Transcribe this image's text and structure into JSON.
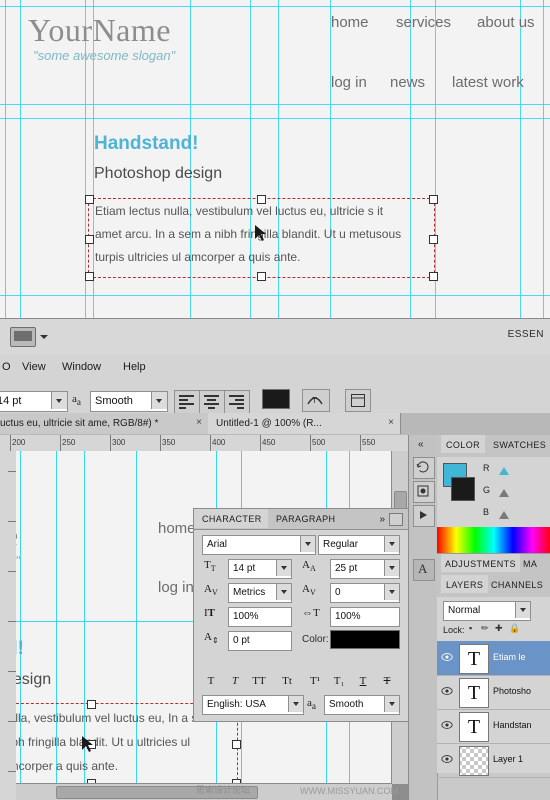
{
  "preview": {
    "brand": "YourName",
    "slogan": "\"some awesome slogan\"",
    "nav_primary": [
      "home",
      "services",
      "about us"
    ],
    "nav_secondary": [
      "log in",
      "news",
      "latest work"
    ],
    "headline": "Handstand!",
    "subhead": "Photoshop design",
    "body": "Etiam lectus nulla, vestibulum vel luctus eu, ultricie s it amet arcu. In a sem a nibh fringilla blandit. Ut u metusous turpis ultricies ul amcorper a quis ante."
  },
  "appchrome": {
    "essentials": "ESSEN",
    "menu": [
      "O",
      "View",
      "Window",
      "Help"
    ],
    "font_size_value": "14 pt",
    "antialias_value": "Smooth",
    "screen_mode_icon": "screen-mode-icon"
  },
  "tabs": [
    {
      "label": "uctus eu, ultricie  sit ame, RGB/8#) *",
      "close": "×",
      "active": false
    },
    {
      "label": "Untitled-1 @ 100% (R...",
      "close": "×",
      "active": true
    }
  ],
  "ruler": {
    "unit_marks": [
      "200",
      "250",
      "300",
      "350",
      "400",
      "450",
      "500",
      "550"
    ]
  },
  "canvas_preview": {
    "nav": [
      "home",
      "log in"
    ],
    "brand_fragment": "e",
    "slogan_fragment": "n\"",
    "headline_fragment": "d!",
    "subhead_fragment": "design",
    "body": "nulla, vestibulum vel luctus eu,   In a sem a nibh fringilla blandit. Ut u ultricies ul amcorper a quis ante."
  },
  "character_panel": {
    "tabs": [
      "CHARACTER",
      "PARAGRAPH"
    ],
    "active_tab": "CHARACTER",
    "expand_icon": "chevron-double-right-icon",
    "menu_icon": "panel-menu-icon",
    "font_family": "Arial",
    "font_style": "Regular",
    "font_size": "14 pt",
    "leading": "25 pt",
    "kerning": "Metrics",
    "tracking": "0",
    "vertical_scale": "100%",
    "horizontal_scale": "100%",
    "baseline_shift": "0 pt",
    "color_label": "Color:",
    "color_value": "#000000",
    "language": "English: USA",
    "antialias": "Smooth",
    "style_buttons": [
      "T",
      "T",
      "TT",
      "Tt",
      "T¹",
      "T₁",
      "T",
      "T"
    ],
    "labels": {
      "size_icon": "font-size-icon",
      "leading_icon": "leading-icon",
      "kerning_icon": "kerning-icon",
      "tracking_icon": "tracking-icon",
      "vscale_icon": "vertical-scale-icon",
      "hscale_icon": "horizontal-scale-icon",
      "baseline_icon": "baseline-shift-icon",
      "lang_icon": "language-icon",
      "aa_icon": "anti-alias-icon"
    }
  },
  "dock": {
    "color_tabs": [
      "COLOR",
      "SWATCHES"
    ],
    "color_channels": [
      "R",
      "G",
      "B"
    ],
    "adjust_tabs": [
      "ADJUSTMENTS",
      "MA"
    ],
    "layer_tabs": [
      "LAYERS",
      "CHANNELS"
    ],
    "blend_mode": "Normal",
    "lock_label": "Lock:",
    "lock_icons": [
      "lock-transparent-icon",
      "lock-pixels-icon",
      "lock-position-icon",
      "lock-all-icon"
    ],
    "layers": [
      {
        "name": "Etiam le",
        "type": "text",
        "selected": true
      },
      {
        "name": "Photosho",
        "type": "text",
        "selected": false
      },
      {
        "name": "Handstan",
        "type": "text",
        "selected": false
      },
      {
        "name": "Layer 1",
        "type": "raster",
        "selected": false
      }
    ]
  },
  "watermark": {
    "left": "思索设计论坛",
    "right": "WWW.MISSYUAN.COM"
  },
  "colors": {
    "guide": "#39d7f2",
    "accent": "#4fb3d6",
    "selection": "#b03030",
    "panel_bg": "#d4d4d4",
    "layer_selected": "#6a93c8"
  }
}
